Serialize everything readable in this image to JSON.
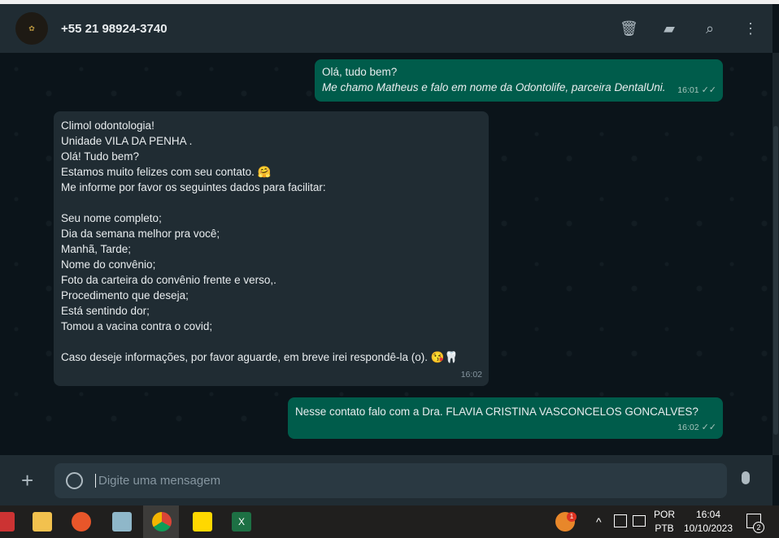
{
  "header": {
    "contact": "+55 21 98924-3740",
    "avatar_text": "CLIMOL",
    "icons": [
      "trash-icon",
      "label-icon",
      "search-icon",
      "more-vert-icon"
    ]
  },
  "messages": [
    {
      "direction": "out",
      "lines": [
        "Olá, tudo bem?",
        "Me chamo Matheus e falo em nome da Odontolife, parceira DentalUni."
      ],
      "time": "16:01",
      "status": "read"
    },
    {
      "direction": "in",
      "lines": [
        "Climol odontologia!",
        "Unidade VILA DA PENHA .",
        "Olá! Tudo bem?",
        "Estamos muito felizes com seu contato. 🤗",
        "Me informe por favor os seguintes dados para facilitar:",
        "",
        "Seu nome completo;",
        "Dia da semana melhor pra você;",
        "Manhã, Tarde;",
        "Nome do convênio;",
        "Foto da carteira do convênio frente e verso,.",
        "Procedimento que deseja;",
        "Está sentindo dor;",
        "Tomou a vacina contra o covid;",
        "",
        "Caso deseje informações, por favor aguarde, em breve irei respondê-la (o). 😘🦷"
      ],
      "time": "16:02"
    },
    {
      "direction": "out",
      "lines": [
        "Nesse contato falo com a Dra. FLAVIA CRISTINA VASCONCELOS GONCALVES?"
      ],
      "time": "16:02",
      "status": "read"
    }
  ],
  "composer": {
    "placeholder": "Digite uma mensagem"
  },
  "taskbar": {
    "apps": [
      "snipping-tool",
      "file-explorer",
      "firefox",
      "notepad",
      "chrome",
      "sticky-notes",
      "excel"
    ],
    "lang1": "POR",
    "lang2": "PTB",
    "time": "16:04",
    "date": "10/10/2023",
    "notifications": "2",
    "badge": "1"
  }
}
